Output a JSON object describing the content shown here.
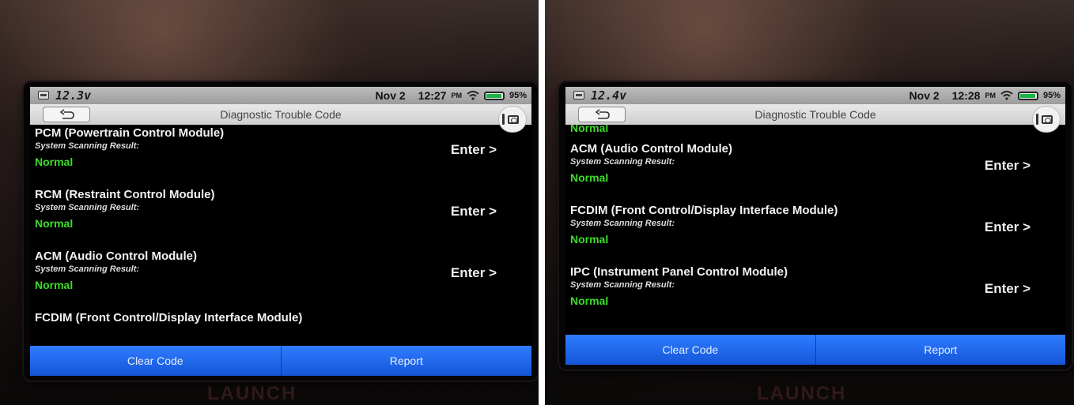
{
  "left": {
    "status_bar": {
      "voltage": "12.3v",
      "date": "Nov 2",
      "time": "12:27",
      "ampm": "PM",
      "battery": "95%"
    },
    "title_bar": {
      "title": "Diagnostic Trouble Code"
    },
    "modules": [
      {
        "name": "PCM (Powertrain Control Module)",
        "result_label": "System Scanning Result:",
        "status": "Normal",
        "enter_label": "Enter >"
      },
      {
        "name": "RCM (Restraint Control Module)",
        "result_label": "System Scanning Result:",
        "status": "Normal",
        "enter_label": "Enter >"
      },
      {
        "name": "ACM (Audio Control Module)",
        "result_label": "System Scanning Result:",
        "status": "Normal",
        "enter_label": "Enter >"
      },
      {
        "name": "FCDIM (Front Control/Display Interface Module)"
      }
    ],
    "bottom_bar": {
      "clear_code": "Clear Code",
      "report": "Report"
    },
    "brand": "LAUNCH"
  },
  "right": {
    "status_bar": {
      "voltage": "12.4v",
      "date": "Nov 2",
      "time": "12:28",
      "ampm": "PM",
      "battery": "95%"
    },
    "title_bar": {
      "title": "Diagnostic Trouble Code"
    },
    "partial_status": "Normal",
    "modules": [
      {
        "name": "ACM (Audio Control Module)",
        "result_label": "System Scanning Result:",
        "status": "Normal",
        "enter_label": "Enter >"
      },
      {
        "name": "FCDIM (Front Control/Display Interface Module)",
        "result_label": "System Scanning Result:",
        "status": "Normal",
        "enter_label": "Enter >"
      },
      {
        "name": "IPC (Instrument Panel Control Module)",
        "result_label": "System Scanning Result:",
        "status": "Normal",
        "enter_label": "Enter >"
      }
    ],
    "bottom_bar": {
      "clear_code": "Clear Code",
      "report": "Report"
    },
    "brand": "LAUNCH"
  },
  "colors": {
    "normal_status": "#3bdc2a",
    "bottom_bar": "#1f67ef",
    "status_bar": "#aaaaaa"
  },
  "icons": [
    "back-arrow-icon",
    "screenshot-camera-icon",
    "wifi-icon",
    "battery-icon",
    "voltage-icon"
  ]
}
